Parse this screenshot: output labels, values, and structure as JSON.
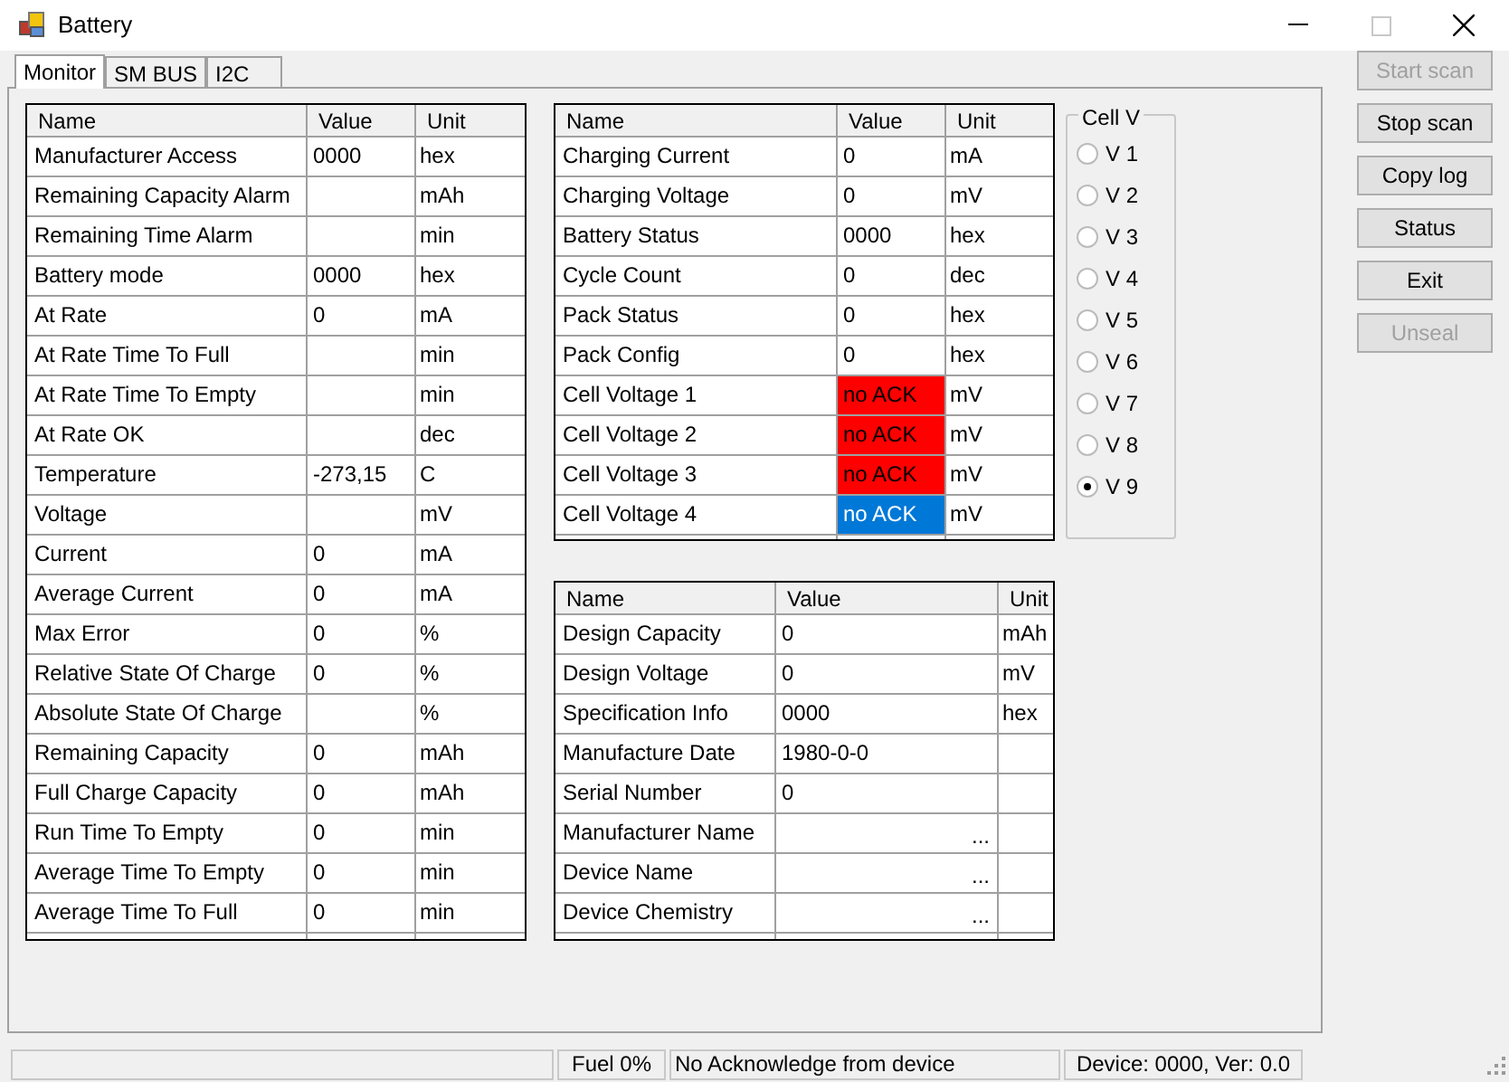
{
  "window": {
    "title": "Battery",
    "buttons": [
      {
        "kind": "minimize",
        "disabled": false
      },
      {
        "kind": "maximize",
        "disabled": true
      },
      {
        "kind": "close",
        "disabled": false
      }
    ]
  },
  "tabs": [
    {
      "label": "Monitor",
      "selected": true
    },
    {
      "label": "SM BUS",
      "selected": false
    },
    {
      "label": "I2C",
      "selected": false
    }
  ],
  "tables": [
    {
      "columns": [
        "Name",
        "Value",
        "Unit"
      ],
      "rows": [
        {
          "name": "Manufacturer Access",
          "value": "0000",
          "unit": "hex"
        },
        {
          "name": "Remaining Capacity Alarm",
          "unit": "mAh"
        },
        {
          "name": "Remaining Time Alarm",
          "unit": "min"
        },
        {
          "name": "Battery mode",
          "value": "0000",
          "unit": "hex"
        },
        {
          "name": "At Rate",
          "value": "0",
          "unit": "mA"
        },
        {
          "name": "At Rate Time To Full",
          "unit": "min"
        },
        {
          "name": "At Rate Time To Empty",
          "unit": "min"
        },
        {
          "name": "At Rate OK",
          "unit": "dec"
        },
        {
          "name": "Temperature",
          "value": "-273,15",
          "unit": "C"
        },
        {
          "name": "Voltage",
          "unit": "mV"
        },
        {
          "name": "Current",
          "value": "0",
          "unit": "mA"
        },
        {
          "name": "Average Current",
          "value": "0",
          "unit": "mA"
        },
        {
          "name": "Max Error",
          "value": "0",
          "unit": "%"
        },
        {
          "name": "Relative State Of Charge",
          "value": "0",
          "unit": "%"
        },
        {
          "name": "Absolute State Of Charge",
          "unit": "%"
        },
        {
          "name": "Remaining Capacity",
          "value": "0",
          "unit": "mAh"
        },
        {
          "name": "Full Charge Capacity",
          "value": "0",
          "unit": "mAh"
        },
        {
          "name": "Run Time To Empty",
          "value": "0",
          "unit": "min"
        },
        {
          "name": "Average Time To Empty",
          "value": "0",
          "unit": "min"
        },
        {
          "name": "Average Time To Full",
          "value": "0",
          "unit": "min"
        }
      ]
    },
    {
      "columns": [
        "Name",
        "Value",
        "Unit"
      ],
      "rows": [
        {
          "name": "Charging Current",
          "value": "0",
          "unit": "mA"
        },
        {
          "name": "Charging Voltage",
          "value": "0",
          "unit": "mV"
        },
        {
          "name": "Battery Status",
          "value": "0000",
          "unit": "hex"
        },
        {
          "name": "Cycle Count",
          "value": "0",
          "unit": "dec"
        },
        {
          "name": "Pack Status",
          "value": "0",
          "unit": "hex"
        },
        {
          "name": "Pack Config",
          "value": "0",
          "unit": "hex"
        },
        {
          "name": "Cell Voltage 1",
          "value": "no ACK",
          "unit": "mV",
          "color": "#ff0000"
        },
        {
          "name": "Cell Voltage 2",
          "value": "no ACK",
          "unit": "mV",
          "color": "#ff0000"
        },
        {
          "name": "Cell Voltage 3",
          "value": "no ACK",
          "unit": "mV",
          "color": "#ff0000"
        },
        {
          "name": "Cell Voltage 4",
          "value": "no ACK",
          "unit": "mV",
          "color": "#0078d7"
        }
      ]
    },
    {
      "columns": [
        "Name",
        "Value",
        "Unit"
      ],
      "rows": [
        {
          "name": "Design Capacity",
          "value": "0",
          "unit": "mAh"
        },
        {
          "name": "Design Voltage",
          "value": "0",
          "unit": "mV"
        },
        {
          "name": "Specification Info",
          "value": "0000",
          "unit": "hex"
        },
        {
          "name": "Manufacture Date",
          "value": "1980-0-0"
        },
        {
          "name": "Serial Number",
          "value": "0"
        },
        {
          "name": "Manufacturer Name",
          "more": "..."
        },
        {
          "name": "Device Name",
          "more": "..."
        },
        {
          "name": "Device Chemistry",
          "more": "..."
        }
      ]
    }
  ],
  "cell_group": {
    "title": "Cell V",
    "options": [
      {
        "label": "V 1",
        "selected": false
      },
      {
        "label": "V 2",
        "selected": false
      },
      {
        "label": "V 3",
        "selected": false
      },
      {
        "label": "V 4",
        "selected": false
      },
      {
        "label": "V 5",
        "selected": false
      },
      {
        "label": "V 6",
        "selected": false
      },
      {
        "label": "V 7",
        "selected": false
      },
      {
        "label": "V 8",
        "selected": false
      },
      {
        "label": "V 9",
        "selected": true
      }
    ]
  },
  "buttons": [
    {
      "label": "Start scan",
      "disabled": true
    },
    {
      "label": "Stop scan",
      "disabled": false
    },
    {
      "label": "Copy log",
      "disabled": false
    },
    {
      "label": "Status",
      "disabled": false
    },
    {
      "label": "Exit",
      "disabled": false
    },
    {
      "label": "Unseal",
      "disabled": true
    }
  ],
  "status_bar": {
    "fields": [
      "Fuel 0%",
      "No Acknowledge from device",
      "Device: 0000, Ver: 0.0"
    ]
  }
}
